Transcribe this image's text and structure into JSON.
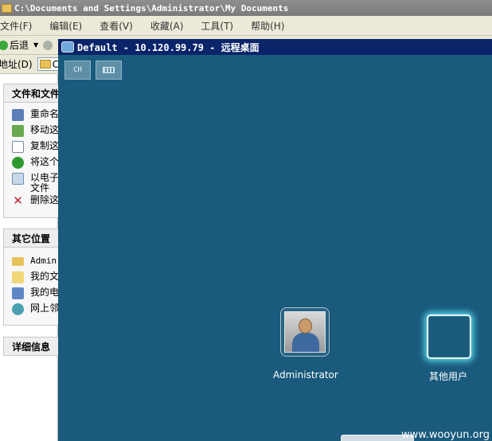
{
  "explorer": {
    "title": "C:\\Documents and Settings\\Administrator\\My Documents",
    "menu": [
      "文件(F)",
      "编辑(E)",
      "查看(V)",
      "收藏(A)",
      "工具(T)",
      "帮助(H)"
    ],
    "toolbar": {
      "back_label": "后退"
    },
    "address": {
      "label": "地址(D)",
      "value": "C"
    },
    "task_groups": [
      {
        "title": "文件和文件",
        "items": [
          {
            "icon": "rename-icon",
            "label": "重命名"
          },
          {
            "icon": "move-icon",
            "label": "移动这"
          },
          {
            "icon": "copy-icon",
            "label": "复制这"
          },
          {
            "icon": "publish-web-icon",
            "label": "将这个"
          },
          {
            "icon": "email-icon",
            "label": "以电子",
            "label2": "文件"
          },
          {
            "icon": "delete-icon",
            "label": "删除这"
          }
        ]
      },
      {
        "title": "其它位置",
        "items": [
          {
            "icon": "folder-icon",
            "label": "Admin"
          },
          {
            "icon": "my-documents-icon",
            "label": "我的文"
          },
          {
            "icon": "my-computer-icon",
            "label": "我的电"
          },
          {
            "icon": "network-icon",
            "label": "网上邻"
          }
        ]
      },
      {
        "title": "详细信息",
        "items": []
      }
    ]
  },
  "rdp": {
    "title": "Default - 10.120.99.79 - 远程桌面",
    "lang_button": "CH",
    "keyboard_icon": "keyboard-icon",
    "users": [
      {
        "name": "Administrator",
        "icon": "user-avatar-icon"
      },
      {
        "name": "其他用户",
        "icon": "blank-user-tile"
      }
    ]
  },
  "watermark": "www.wooyun.org"
}
